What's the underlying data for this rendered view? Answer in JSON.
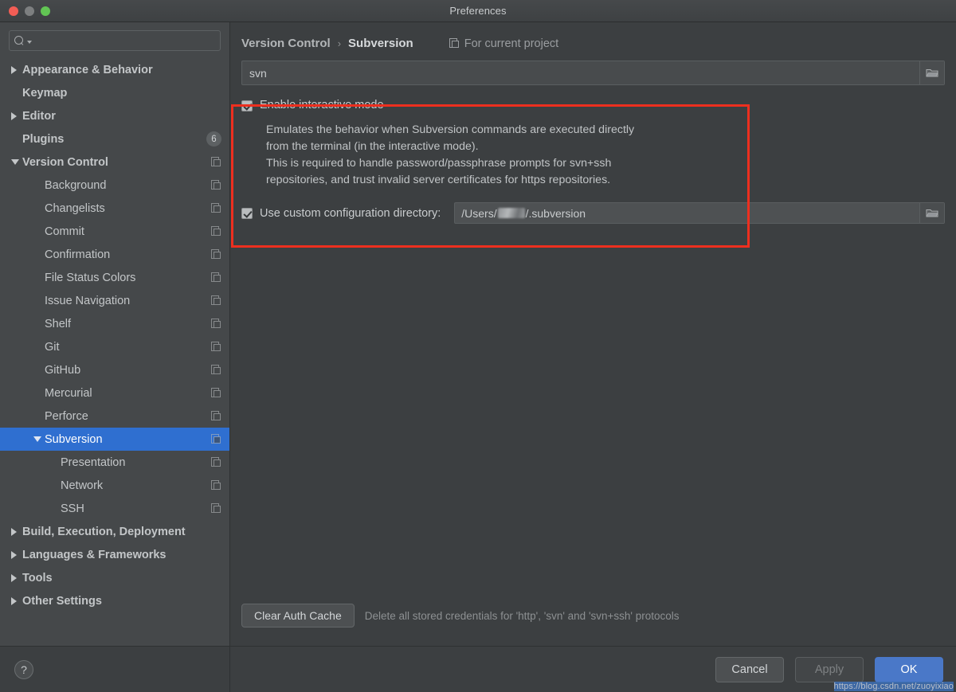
{
  "window": {
    "title": "Preferences",
    "traffic_lights": [
      "close-red",
      "minimize-yellow",
      "zoom-green"
    ]
  },
  "sidebar": {
    "search": {
      "value": "",
      "placeholder": ""
    },
    "items": [
      {
        "label": "Appearance & Behavior",
        "level": 0,
        "arrow": "right",
        "icon": null,
        "badge": null,
        "selected": false
      },
      {
        "label": "Keymap",
        "level": 0,
        "arrow": "none",
        "icon": null,
        "badge": null,
        "selected": false
      },
      {
        "label": "Editor",
        "level": 0,
        "arrow": "right",
        "icon": null,
        "badge": null,
        "selected": false
      },
      {
        "label": "Plugins",
        "level": 0,
        "arrow": "none",
        "icon": null,
        "badge": "6",
        "selected": false
      },
      {
        "label": "Version Control",
        "level": 0,
        "arrow": "down",
        "icon": "copy-icon",
        "badge": null,
        "selected": false
      },
      {
        "label": "Background",
        "level": 1,
        "arrow": "none",
        "icon": "copy-icon",
        "badge": null,
        "selected": false
      },
      {
        "label": "Changelists",
        "level": 1,
        "arrow": "none",
        "icon": "copy-icon",
        "badge": null,
        "selected": false
      },
      {
        "label": "Commit",
        "level": 1,
        "arrow": "none",
        "icon": "copy-icon",
        "badge": null,
        "selected": false
      },
      {
        "label": "Confirmation",
        "level": 1,
        "arrow": "none",
        "icon": "copy-icon",
        "badge": null,
        "selected": false
      },
      {
        "label": "File Status Colors",
        "level": 1,
        "arrow": "none",
        "icon": "copy-icon",
        "badge": null,
        "selected": false
      },
      {
        "label": "Issue Navigation",
        "level": 1,
        "arrow": "none",
        "icon": "copy-icon",
        "badge": null,
        "selected": false
      },
      {
        "label": "Shelf",
        "level": 1,
        "arrow": "none",
        "icon": "copy-icon",
        "badge": null,
        "selected": false
      },
      {
        "label": "Git",
        "level": 1,
        "arrow": "none",
        "icon": "copy-icon",
        "badge": null,
        "selected": false
      },
      {
        "label": "GitHub",
        "level": 1,
        "arrow": "none",
        "icon": "copy-icon",
        "badge": null,
        "selected": false
      },
      {
        "label": "Mercurial",
        "level": 1,
        "arrow": "none",
        "icon": "copy-icon",
        "badge": null,
        "selected": false
      },
      {
        "label": "Perforce",
        "level": 1,
        "arrow": "none",
        "icon": "copy-icon",
        "badge": null,
        "selected": false
      },
      {
        "label": "Subversion",
        "level": 1,
        "arrow": "down",
        "icon": "copy-icon",
        "badge": null,
        "selected": true
      },
      {
        "label": "Presentation",
        "level": 2,
        "arrow": "none",
        "icon": "copy-icon",
        "badge": null,
        "selected": false
      },
      {
        "label": "Network",
        "level": 2,
        "arrow": "none",
        "icon": "copy-icon",
        "badge": null,
        "selected": false
      },
      {
        "label": "SSH",
        "level": 2,
        "arrow": "none",
        "icon": "copy-icon",
        "badge": null,
        "selected": false
      },
      {
        "label": "Build, Execution, Deployment",
        "level": 0,
        "arrow": "right",
        "icon": null,
        "badge": null,
        "selected": false
      },
      {
        "label": "Languages & Frameworks",
        "level": 0,
        "arrow": "right",
        "icon": null,
        "badge": null,
        "selected": false
      },
      {
        "label": "Tools",
        "level": 0,
        "arrow": "right",
        "icon": null,
        "badge": null,
        "selected": false
      },
      {
        "label": "Other Settings",
        "level": 0,
        "arrow": "right",
        "icon": null,
        "badge": null,
        "selected": false
      }
    ],
    "help_label": "?"
  },
  "main": {
    "breadcrumb": {
      "parent": "Version Control",
      "separator": "›",
      "current": "Subversion"
    },
    "scope": {
      "icon": "copy-icon",
      "label": "For current project"
    },
    "svn_path": {
      "value": "svn",
      "browse_icon": "folder-icon"
    },
    "interactive": {
      "checked": true,
      "label": "Enable interactive mode",
      "description_lines": [
        "Emulates the behavior when Subversion commands are executed directly",
        "from the terminal (in the interactive mode).",
        "This is required to handle password/passphrase prompts for svn+ssh",
        "repositories, and trust invalid server certificates for https repositories."
      ]
    },
    "custom_dir": {
      "checked": true,
      "label": "Use custom configuration directory:",
      "value_prefix": "/Users/",
      "value_redacted": true,
      "value_suffix": "/.subversion",
      "browse_icon": "folder-icon"
    },
    "auth": {
      "button_label": "Clear Auth Cache",
      "hint": "Delete all stored credentials for 'http', 'svn' and 'svn+ssh' protocols"
    },
    "highlight_color": "#ed2f1f"
  },
  "footer": {
    "cancel_label": "Cancel",
    "apply_label": "Apply",
    "ok_label": "OK",
    "ok_color": "#4a78c8",
    "watermark": "https://blog.csdn.net/zuoyixiao"
  }
}
